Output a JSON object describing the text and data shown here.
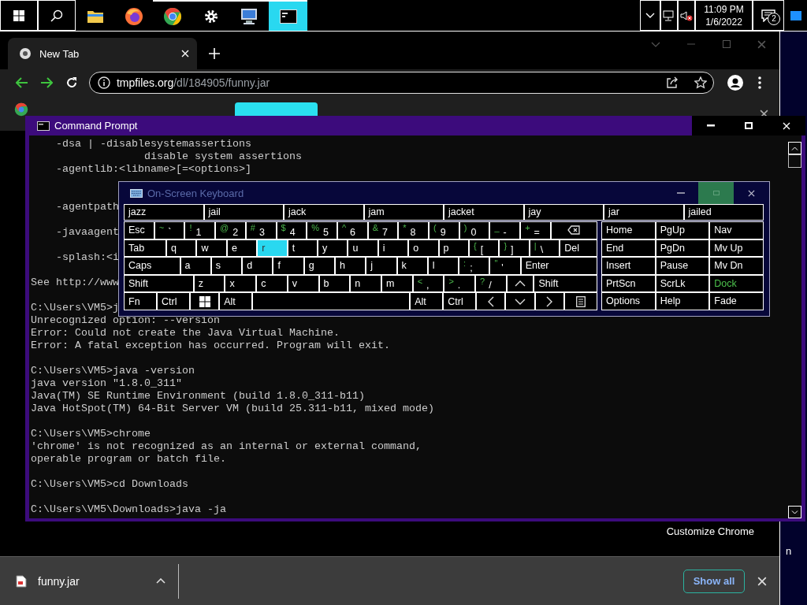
{
  "taskbar": {
    "apps": [
      {
        "kind": "folder",
        "running": false,
        "selected": false
      },
      {
        "kind": "firefox",
        "running": false,
        "selected": false
      },
      {
        "kind": "chrome",
        "running": true,
        "selected": false
      },
      {
        "kind": "gear",
        "running": true,
        "selected": false
      },
      {
        "kind": "remote",
        "running": true,
        "selected": false
      },
      {
        "kind": "console",
        "running": true,
        "selected": true
      }
    ],
    "clock": {
      "time": "11:09 PM",
      "date": "1/6/2022"
    },
    "notifications": {
      "count": "2"
    }
  },
  "browser": {
    "tab": {
      "title": "New Tab"
    },
    "address": {
      "url": "**tmpfiles.org**/dl/184905/funny.jar"
    },
    "customize_label": "Customize Chrome",
    "download": {
      "file": "funny.jar",
      "button": "Show all"
    }
  },
  "desktop": {
    "edge_text": "n"
  },
  "console": {
    "title": "Command Prompt",
    "lines": [
      {
        "kind": "text",
        "text": "    -dsa | -disablesystemassertions"
      },
      {
        "kind": "text",
        "text": "                  disable system assertions"
      },
      {
        "kind": "text",
        "text": "    -agentlib:<libname>[=<options>]"
      },
      {
        "kind": "blank"
      },
      {
        "kind": "blank"
      },
      {
        "kind": "text",
        "text": "    -agentpath"
      },
      {
        "kind": "blank"
      },
      {
        "kind": "text",
        "text": "    -javaagent"
      },
      {
        "kind": "blank"
      },
      {
        "kind": "text",
        "text": "    -splash:<i"
      },
      {
        "kind": "blank"
      },
      {
        "kind": "text",
        "text": "See http://www"
      },
      {
        "kind": "blank"
      },
      {
        "kind": "text",
        "text": "C:\\Users\\VM5>j"
      },
      {
        "kind": "text",
        "text": "Unrecognized option: --version"
      },
      {
        "kind": "text",
        "text": "Error: Could not create the Java Virtual Machine."
      },
      {
        "kind": "text",
        "text": "Error: A fatal exception has occurred. Program will exit."
      },
      {
        "kind": "blank"
      },
      {
        "kind": "text",
        "text": "C:\\Users\\VM5>java -version"
      },
      {
        "kind": "text",
        "text": "java version \"1.8.0_311\""
      },
      {
        "kind": "text",
        "text": "Java(TM) SE Runtime Environment (build 1.8.0_311-b11)"
      },
      {
        "kind": "text",
        "text": "Java HotSpot(TM) 64-Bit Server VM (build 25.311-b11, mixed mode)"
      },
      {
        "kind": "blank"
      },
      {
        "kind": "text",
        "text": "C:\\Users\\VM5>chrome"
      },
      {
        "kind": "text",
        "text": "'chrome' is not recognized as an internal or external command,"
      },
      {
        "kind": "text",
        "text": "operable program or batch file."
      },
      {
        "kind": "blank"
      },
      {
        "kind": "text",
        "text": "C:\\Users\\VM5>cd Downloads"
      },
      {
        "kind": "blank"
      },
      {
        "kind": "text",
        "text": "C:\\Users\\VM5\\Downloads>java -ja"
      }
    ]
  },
  "keyboard": {
    "title": "On-Screen Keyboard",
    "suggestions": [
      "jazz",
      "jail",
      "jack",
      "jam",
      "jacket",
      "jay",
      "jar",
      "jailed"
    ],
    "rows": [
      {
        "keys": [
          {
            "kind": "mod",
            "label": "Esc",
            "pressed": false
          },
          {
            "kind": "symbol",
            "shift": "~",
            "label": "`",
            "pressed": false
          },
          {
            "kind": "symbol",
            "shift": "!",
            "label": "1",
            "pressed": false
          },
          {
            "kind": "symbol",
            "shift": "@",
            "label": "2",
            "pressed": false
          },
          {
            "kind": "symbol",
            "shift": "#",
            "label": "3",
            "pressed": false
          },
          {
            "kind": "symbol",
            "shift": "$",
            "label": "4",
            "pressed": false
          },
          {
            "kind": "symbol",
            "shift": "%",
            "label": "5",
            "pressed": false
          },
          {
            "kind": "symbol",
            "shift": "^",
            "label": "6",
            "pressed": false
          },
          {
            "kind": "symbol",
            "shift": "&",
            "label": "7",
            "pressed": false
          },
          {
            "kind": "symbol",
            "shift": "*",
            "label": "8",
            "pressed": false
          },
          {
            "kind": "symbol",
            "shift": "(",
            "label": "9",
            "pressed": false
          },
          {
            "kind": "symbol",
            "shift": ")",
            "label": "0",
            "pressed": false
          },
          {
            "kind": "symbol",
            "shift": "_",
            "label": "-",
            "pressed": false
          },
          {
            "kind": "symbol",
            "shift": "+",
            "label": "=",
            "pressed": false
          },
          {
            "kind": "backspace",
            "pressed": false
          }
        ]
      },
      {
        "keys": [
          {
            "kind": "mod",
            "label": "Tab",
            "pressed": false
          },
          {
            "kind": "letter",
            "label": "q",
            "pressed": false
          },
          {
            "kind": "letter",
            "label": "w",
            "pressed": false
          },
          {
            "kind": "letter",
            "label": "e",
            "pressed": false
          },
          {
            "kind": "letter",
            "label": "r",
            "pressed": true
          },
          {
            "kind": "letter",
            "label": "t",
            "pressed": false
          },
          {
            "kind": "letter",
            "label": "y",
            "pressed": false
          },
          {
            "kind": "letter",
            "label": "u",
            "pressed": false
          },
          {
            "kind": "letter",
            "label": "i",
            "pressed": false
          },
          {
            "kind": "letter",
            "label": "o",
            "pressed": false
          },
          {
            "kind": "letter",
            "label": "p",
            "pressed": false
          },
          {
            "kind": "symbol",
            "shift": "{",
            "label": "[",
            "pressed": false
          },
          {
            "kind": "symbol",
            "shift": "}",
            "label": "]",
            "pressed": false
          },
          {
            "kind": "symbol",
            "shift": "|",
            "label": "\\",
            "pressed": false
          },
          {
            "kind": "mod",
            "label": "Del",
            "pressed": false
          }
        ]
      },
      {
        "keys": [
          {
            "kind": "mod",
            "label": "Caps",
            "pressed": false
          },
          {
            "kind": "letter",
            "label": "a",
            "pressed": false
          },
          {
            "kind": "letter",
            "label": "s",
            "pressed": false
          },
          {
            "kind": "letter",
            "label": "d",
            "pressed": false
          },
          {
            "kind": "letter",
            "label": "f",
            "pressed": false
          },
          {
            "kind": "letter",
            "label": "g",
            "pressed": false
          },
          {
            "kind": "letter",
            "label": "h",
            "pressed": false
          },
          {
            "kind": "letter",
            "label": "j",
            "pressed": false
          },
          {
            "kind": "letter",
            "label": "k",
            "pressed": false
          },
          {
            "kind": "letter",
            "label": "l",
            "pressed": false
          },
          {
            "kind": "symbol",
            "shift": ":",
            "label": ";",
            "pressed": false
          },
          {
            "kind": "symbol",
            "shift": "\"",
            "label": "'",
            "pressed": false
          },
          {
            "kind": "mod",
            "label": "Enter",
            "pressed": false
          }
        ]
      },
      {
        "keys": [
          {
            "kind": "mod",
            "label": "Shift",
            "pressed": false
          },
          {
            "kind": "letter",
            "label": "z",
            "pressed": false
          },
          {
            "kind": "letter",
            "label": "x",
            "pressed": false
          },
          {
            "kind": "letter",
            "label": "c",
            "pressed": false
          },
          {
            "kind": "letter",
            "label": "v",
            "pressed": false
          },
          {
            "kind": "letter",
            "label": "b",
            "pressed": false
          },
          {
            "kind": "letter",
            "label": "n",
            "pressed": false
          },
          {
            "kind": "letter",
            "label": "m",
            "pressed": false
          },
          {
            "kind": "symbol",
            "shift": "<",
            "label": ",",
            "pressed": false
          },
          {
            "kind": "symbol",
            "shift": ">",
            "label": ".",
            "pressed": false
          },
          {
            "kind": "symbol",
            "shift": "?",
            "label": "/",
            "pressed": false
          },
          {
            "kind": "up",
            "pressed": false
          },
          {
            "kind": "mod",
            "label": "Shift",
            "pressed": false
          }
        ]
      },
      {
        "keys": [
          {
            "kind": "mod",
            "label": "Fn",
            "pressed": false
          },
          {
            "kind": "mod",
            "label": "Ctrl",
            "pressed": false
          },
          {
            "kind": "windows",
            "pressed": false
          },
          {
            "kind": "mod",
            "label": "Alt",
            "pressed": false
          },
          {
            "kind": "space",
            "pressed": false
          },
          {
            "kind": "mod",
            "label": "Alt",
            "pressed": false
          },
          {
            "kind": "mod",
            "label": "Ctrl",
            "pressed": false
          },
          {
            "kind": "left",
            "pressed": false
          },
          {
            "kind": "down",
            "pressed": false
          },
          {
            "kind": "right",
            "pressed": false
          },
          {
            "kind": "menu",
            "pressed": false
          }
        ]
      }
    ],
    "nav": [
      {
        "label": "Home",
        "active": false
      },
      {
        "label": "PgUp",
        "active": false
      },
      {
        "label": "Nav",
        "active": false
      },
      {
        "label": "End",
        "active": false
      },
      {
        "label": "PgDn",
        "active": false
      },
      {
        "label": "Mv Up",
        "active": false
      },
      {
        "label": "Insert",
        "active": false
      },
      {
        "label": "Pause",
        "active": false
      },
      {
        "label": "Mv Dn",
        "active": false
      },
      {
        "label": "PrtScn",
        "active": false
      },
      {
        "label": "ScrLk",
        "active": false
      },
      {
        "label": "Dock",
        "active": true
      },
      {
        "label": "Options",
        "active": false
      },
      {
        "label": "Help",
        "active": false
      },
      {
        "label": "Fade",
        "active": false
      }
    ]
  }
}
